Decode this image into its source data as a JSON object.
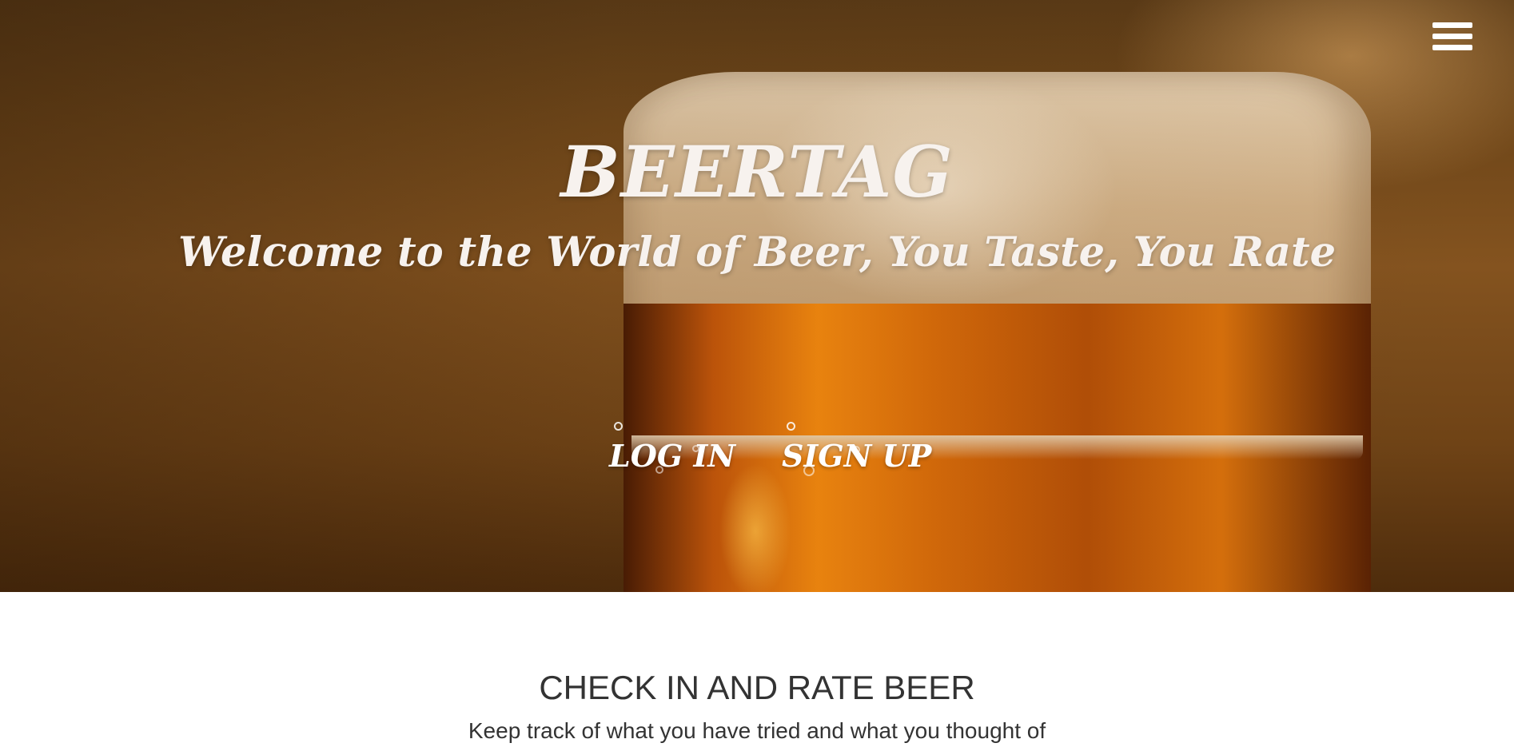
{
  "hero": {
    "brand": "BEERTAG",
    "tagline": "Welcome to the World of Beer, You Taste, You Rate",
    "background_image": "beer-glass-with-foam"
  },
  "header": {
    "menu_icon": "hamburger-menu-icon"
  },
  "auth_nav": {
    "login_label": "LOG IN",
    "signup_label": "SIGN UP"
  },
  "feature": {
    "title": "CHECK IN AND RATE BEER",
    "text": "Keep track of what you have tried and what you thought of"
  },
  "colors": {
    "hero_text": "#f7f2ee",
    "body_text": "#333333",
    "background": "#ffffff"
  }
}
